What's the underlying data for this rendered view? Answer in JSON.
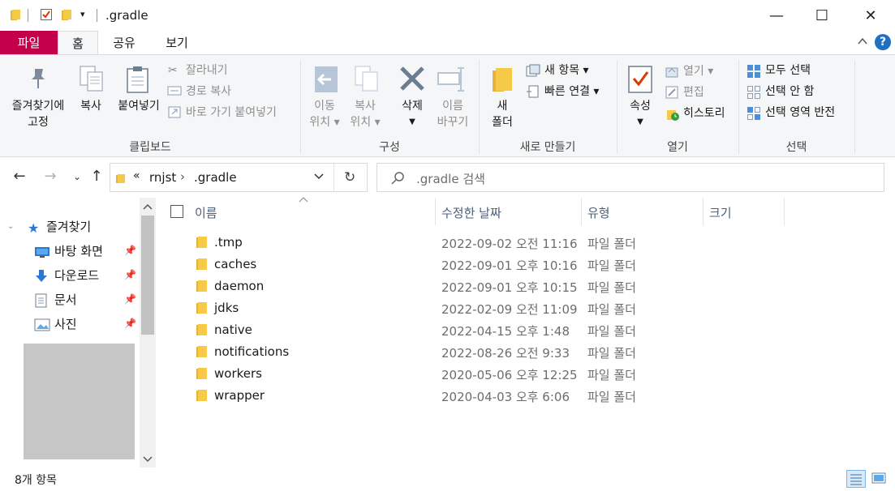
{
  "window": {
    "title": ".gradle",
    "controls": {
      "minimize": "—",
      "maximize": "☐",
      "close": "✕"
    },
    "qa_dropdown": "▾"
  },
  "tabs": [
    "파일",
    "홈",
    "공유",
    "보기"
  ],
  "ribbon": {
    "clipboard": {
      "group_label": "클립보드",
      "pin_line1": "즐겨찾기에",
      "pin_line2": "고정",
      "copy": "복사",
      "paste": "붙여넣기",
      "cut": "잘라내기",
      "copy_path": "경로 복사",
      "paste_shortcut": "바로 가기 붙여넣기"
    },
    "organize": {
      "group_label": "구성",
      "move_line1": "이동",
      "move_line2": "위치",
      "copyto_line1": "복사",
      "copyto_line2": "위치",
      "delete": "삭제",
      "rename_line1": "이름",
      "rename_line2": "바꾸기"
    },
    "new": {
      "group_label": "새로 만들기",
      "new_folder_line1": "새",
      "new_folder_line2": "폴더",
      "new_item": "새 항목",
      "easy_access": "빠른 연결"
    },
    "open": {
      "group_label": "열기",
      "properties": "속성",
      "open": "열기",
      "edit": "편집",
      "history": "히스토리"
    },
    "select": {
      "group_label": "선택",
      "select_all": "모두 선택",
      "select_none": "선택 안 함",
      "invert": "선택 영역 반전"
    }
  },
  "address": {
    "overflow": "«",
    "crumbs": [
      "rnjst",
      ".gradle"
    ],
    "separator": "›",
    "search_placeholder": ".gradle 검색"
  },
  "navpane": {
    "quick_access": "즐겨찾기",
    "items": [
      "바탕 화면",
      "다운로드",
      "문서",
      "사진"
    ]
  },
  "columns": {
    "name": "이름",
    "date": "수정한 날짜",
    "type": "유형",
    "size": "크기"
  },
  "files": [
    {
      "name": ".tmp",
      "date": "2022-09-02 오전 11:16",
      "type": "파일 폴더"
    },
    {
      "name": "caches",
      "date": "2022-09-01 오후 10:16",
      "type": "파일 폴더"
    },
    {
      "name": "daemon",
      "date": "2022-09-01 오후 10:15",
      "type": "파일 폴더"
    },
    {
      "name": "jdks",
      "date": "2022-02-09 오전 11:09",
      "type": "파일 폴더"
    },
    {
      "name": "native",
      "date": "2022-04-15 오후 1:48",
      "type": "파일 폴더"
    },
    {
      "name": "notifications",
      "date": "2022-08-26 오전 9:33",
      "type": "파일 폴더"
    },
    {
      "name": "workers",
      "date": "2020-05-06 오후 12:25",
      "type": "파일 폴더"
    },
    {
      "name": "wrapper",
      "date": "2020-04-03 오후 6:06",
      "type": "파일 폴더"
    }
  ],
  "status": {
    "item_count": "8개 항목"
  },
  "colors": {
    "file_tab": "#c5004b",
    "help": "#1f6fc5",
    "accent_blue": "#2b78d4"
  }
}
